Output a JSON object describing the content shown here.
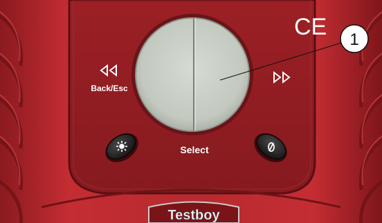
{
  "device": {
    "brand": "Testboy",
    "certification_mark": "CE",
    "body_color": "#b3262b",
    "panel_color": "#8e1d22",
    "button_color": "#c9cfc6"
  },
  "controls": {
    "back_label": "Back/Esc",
    "back_icon": "double-arrow-left-icon",
    "forward_icon": "double-arrow-right-icon",
    "select_label": "Select",
    "light_icon": "sun-icon",
    "power_icon": "power-icon"
  },
  "callout": {
    "number": "1"
  }
}
